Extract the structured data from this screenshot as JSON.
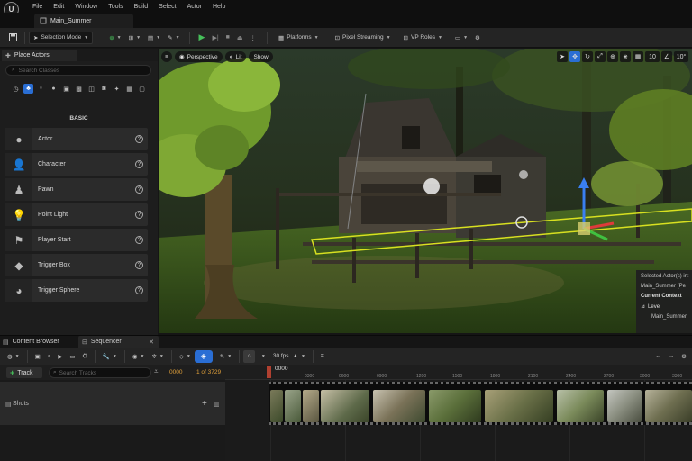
{
  "menu": [
    "File",
    "Edit",
    "Window",
    "Tools",
    "Build",
    "Select",
    "Actor",
    "Help"
  ],
  "level_tab": "Main_Summer",
  "toolbar": {
    "selection_mode": "Selection Mode",
    "platforms": "Platforms",
    "pixel_streaming": "Pixel Streaming",
    "vp_roles": "VP Roles"
  },
  "place_actors": {
    "tab_label": "Place Actors",
    "search_placeholder": "Search Classes",
    "section": "BASIC",
    "items": [
      "Actor",
      "Character",
      "Pawn",
      "Point Light",
      "Player Start",
      "Trigger Box",
      "Trigger Sphere"
    ]
  },
  "viewport": {
    "perspective": "Perspective",
    "lit": "Lit",
    "show": "Show",
    "grid_snap": "10",
    "rot_snap": "10°",
    "outliner": {
      "line1": "Selected Actor(s) in:",
      "line2": "Main_Summer (Pe",
      "line3": "Current Context",
      "line4": "Level",
      "line5": "Main_Summer"
    }
  },
  "bottom_tabs": {
    "content_browser": "Content Browser",
    "sequencer": "Sequencer"
  },
  "sequencer": {
    "fps": "30 fps",
    "track_button": "Track",
    "search_placeholder": "Search Tracks",
    "current_frame": "0000",
    "frame_range": "1 of 3729",
    "playhead": "0000",
    "shots_label": "Shots",
    "ruler_ticks": [
      "0300",
      "0600",
      "0900",
      "1200",
      "1500",
      "1800",
      "2100",
      "2400",
      "2700",
      "3000",
      "3300",
      "3600"
    ]
  },
  "colors": {
    "accent_blue": "#2a6ed4",
    "playhead_red": "#b04030",
    "frame_orange": "#e0a03a",
    "selection_yellow": "#d8e020"
  }
}
